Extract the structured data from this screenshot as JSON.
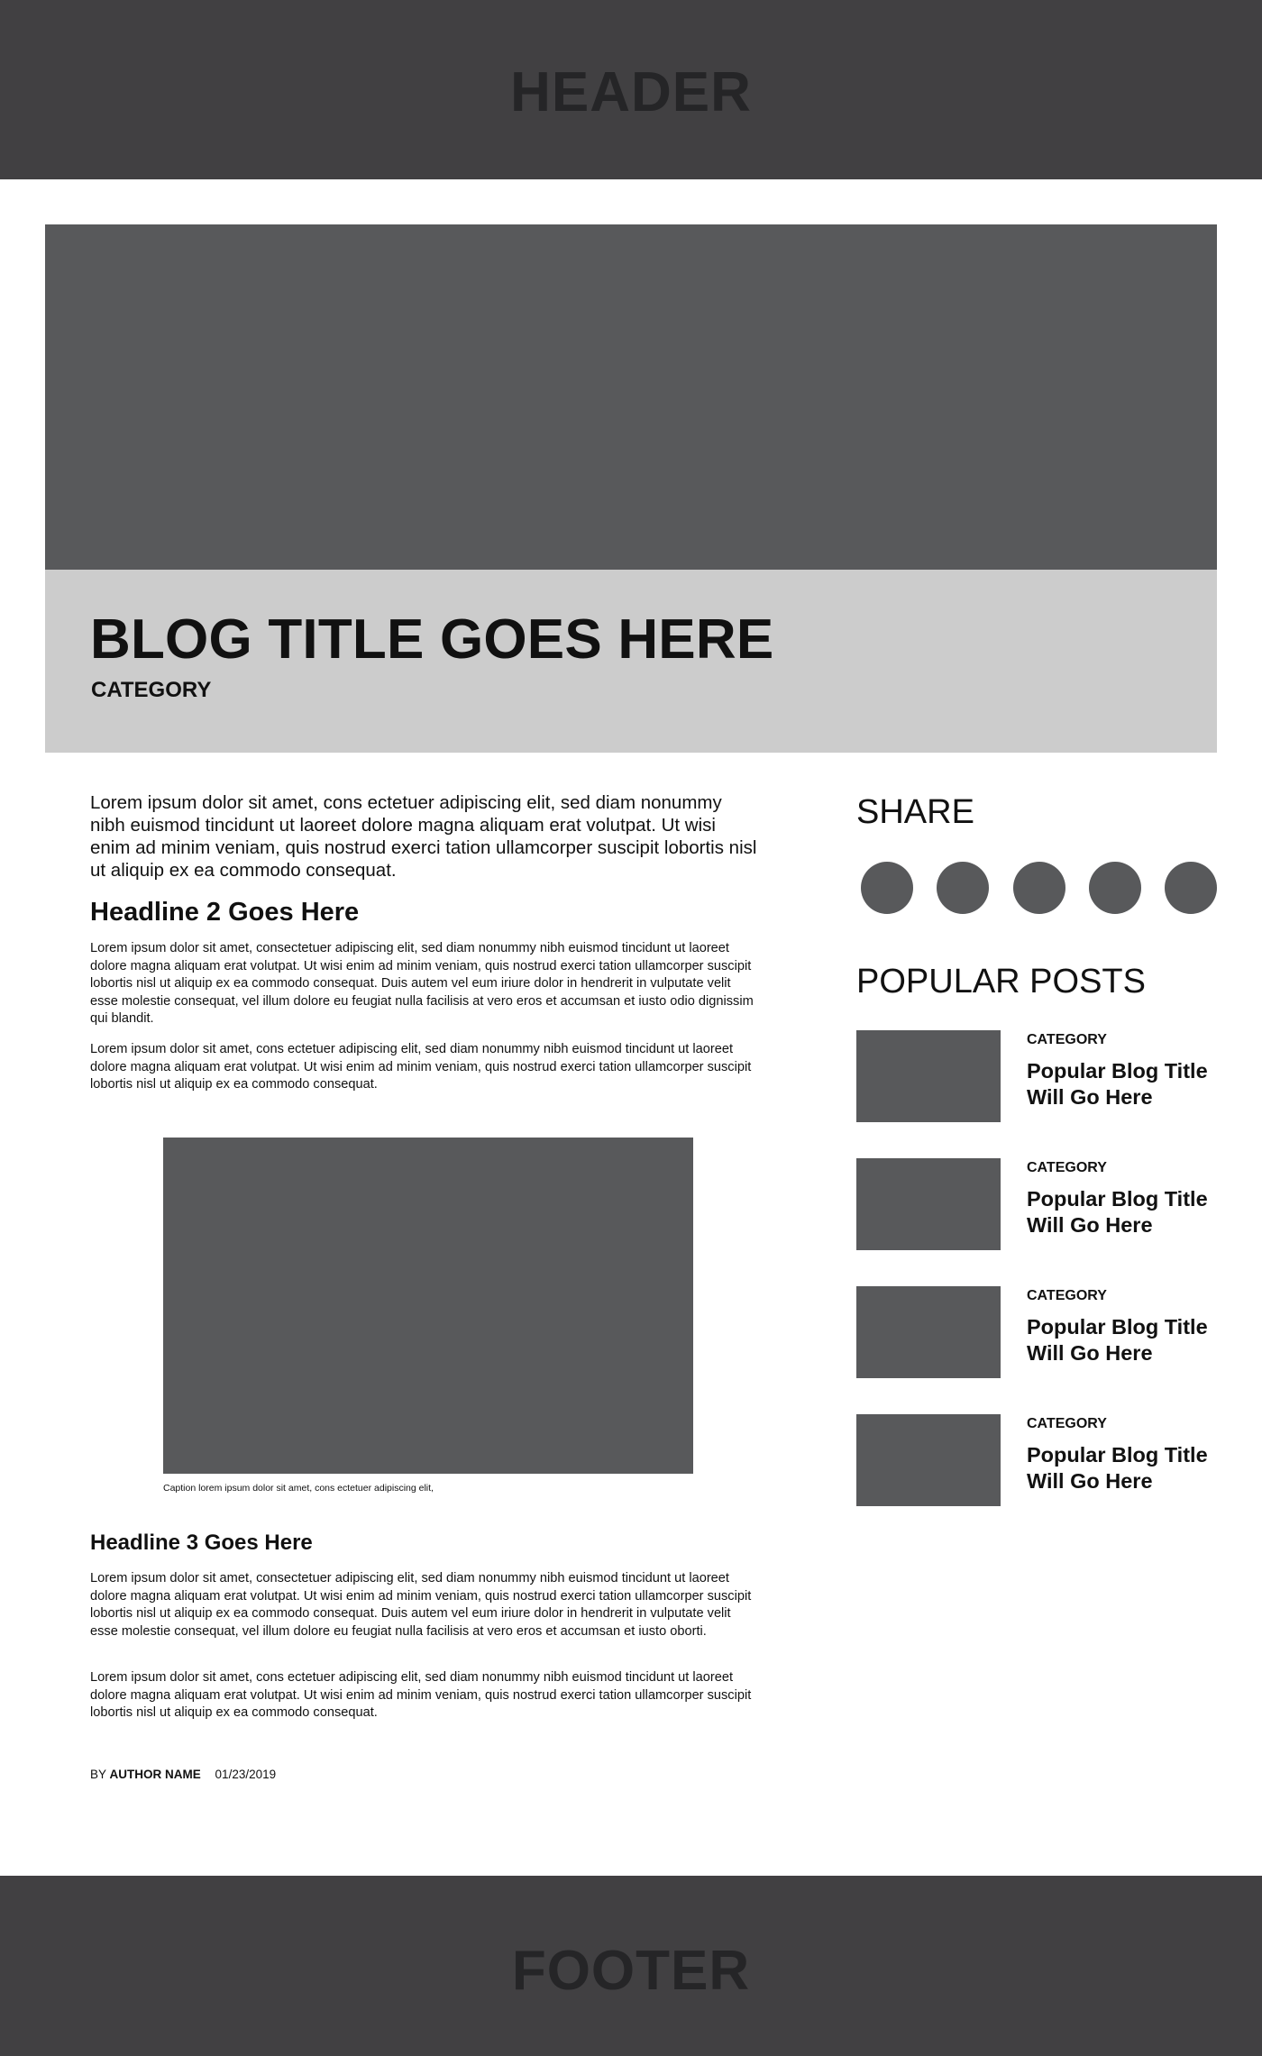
{
  "header": {
    "label": "HEADER"
  },
  "hero": {
    "title": "BLOG TITLE GOES HERE",
    "category": "CATEGORY"
  },
  "article": {
    "intro": "Lorem ipsum dolor sit amet, cons ectetuer adipiscing elit, sed diam nonummy nibh euismod tincidunt ut laoreet dolore magna aliquam erat volutpat. Ut wisi enim ad minim veniam, quis nostrud exerci tation ullamcorper suscipit lobortis nisl ut aliquip ex ea commodo consequat.",
    "headline2": "Headline 2 Goes Here",
    "p1": "Lorem ipsum dolor sit amet, consectetuer adipiscing elit, sed diam nonummy nibh euismod tincidunt ut laoreet dolore magna aliquam erat volutpat. Ut wisi enim ad minim veniam, quis nostrud exerci tation ullamcorper suscipit lobortis nisl ut aliquip ex ea commodo consequat. Duis autem vel eum iriure dolor in hendrerit in vulputate velit esse molestie consequat, vel illum dolore eu feugiat nulla facilisis at vero eros et accumsan et iusto odio dignissim qui blandit.",
    "p2": "Lorem ipsum dolor sit amet, cons ectetuer adipiscing elit, sed diam nonummy nibh euismod tincidunt ut laoreet dolore magna aliquam erat volutpat. Ut wisi enim ad minim veniam, quis nostrud exerci tation ullamcorper suscipit lobortis nisl ut aliquip ex ea commodo consequat.",
    "caption": "Caption lorem ipsum dolor sit amet, cons ectetuer adipiscing elit,",
    "headline3": "Headline 3 Goes Here",
    "p3": "Lorem ipsum dolor sit amet, consectetuer adipiscing elit, sed diam nonummy nibh euismod tincidunt ut laoreet dolore magna aliquam erat volutpat. Ut wisi enim ad minim veniam, quis nostrud exerci tation ullamcorper suscipit lobortis nisl ut aliquip ex ea commodo consequat. Duis autem vel eum iriure dolor in hendrerit in vulputate velit esse molestie consequat, vel illum dolore eu feugiat nulla facilisis at vero eros et accumsan et iusto oborti.",
    "p4": "Lorem ipsum dolor sit amet, cons ectetuer adipiscing elit, sed diam nonummy nibh euismod tincidunt ut laoreet dolore magna aliquam erat volutpat. Ut wisi enim ad minim veniam, quis nostrud exerci tation ullamcorper suscipit lobortis nisl ut aliquip ex ea commodo consequat.",
    "byline_prefix": "BY",
    "author": "AUTHOR NAME",
    "date": "01/23/2019"
  },
  "sidebar": {
    "share_title": "SHARE",
    "popular_title": "POPULAR POSTS",
    "posts": [
      {
        "category": "CATEGORY",
        "title": "Popular Blog Title Will Go Here"
      },
      {
        "category": "CATEGORY",
        "title": "Popular Blog Title Will Go Here"
      },
      {
        "category": "CATEGORY",
        "title": "Popular Blog Title Will Go Here"
      },
      {
        "category": "CATEGORY",
        "title": "Popular Blog Title Will Go Here"
      }
    ]
  },
  "footer": {
    "label": "FOOTER"
  },
  "colors": {
    "header_footer_bg": "#414042",
    "placeholder_gray": "#58595b",
    "title_band_bg": "#cccccc"
  }
}
